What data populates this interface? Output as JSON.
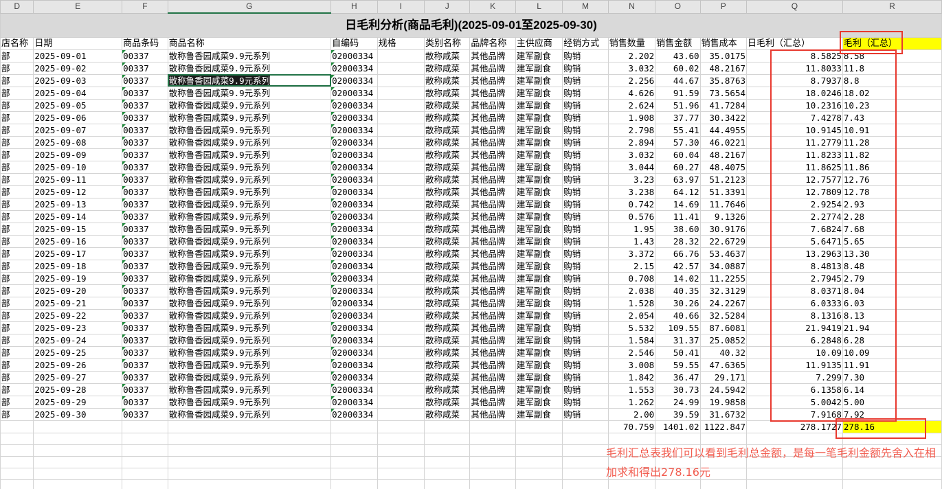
{
  "columns": [
    "D",
    "E",
    "F",
    "G",
    "H",
    "I",
    "J",
    "K",
    "L",
    "M",
    "N",
    "O",
    "P",
    "Q",
    "R"
  ],
  "title": "日毛利分析(商品毛利)(2025-09-01至2025-09-30)",
  "headers": [
    "店名称",
    "日期",
    "商品条码",
    "商品名称",
    "自编码",
    "规格",
    "类别名称",
    "品牌名称",
    "主供应商",
    "经销方式",
    "销售数量",
    "销售金额",
    "销售成本",
    "日毛利（汇总）",
    "毛利（汇总）"
  ],
  "rows": [
    [
      "部",
      "2025-09-01",
      "00337",
      "散称鲁香园咸菜9.9元系列",
      "02000334",
      "",
      "散称咸菜",
      "其他品牌",
      "建军副食",
      "购销",
      "2.202",
      "43.60",
      "35.0175",
      "8.5825",
      "8.58"
    ],
    [
      "部",
      "2025-09-02",
      "00337",
      "散称鲁香园咸菜9.9元系列",
      "02000334",
      "",
      "散称咸菜",
      "其他品牌",
      "建军副食",
      "购销",
      "3.032",
      "60.02",
      "48.2167",
      "11.8033",
      "11.8"
    ],
    [
      "部",
      "2025-09-03",
      "00337",
      "散称鲁香园咸菜9.9元系列",
      "02000334",
      "",
      "散称咸菜",
      "其他品牌",
      "建军副食",
      "购销",
      "2.256",
      "44.67",
      "35.8763",
      "8.7937",
      "8.8"
    ],
    [
      "部",
      "2025-09-04",
      "00337",
      "散称鲁香园咸菜9.9元系列",
      "02000334",
      "",
      "散称咸菜",
      "其他品牌",
      "建军副食",
      "购销",
      "4.626",
      "91.59",
      "73.5654",
      "18.0246",
      "18.02"
    ],
    [
      "部",
      "2025-09-05",
      "00337",
      "散称鲁香园咸菜9.9元系列",
      "02000334",
      "",
      "散称咸菜",
      "其他品牌",
      "建军副食",
      "购销",
      "2.624",
      "51.96",
      "41.7284",
      "10.2316",
      "10.23"
    ],
    [
      "部",
      "2025-09-06",
      "00337",
      "散称鲁香园咸菜9.9元系列",
      "02000334",
      "",
      "散称咸菜",
      "其他品牌",
      "建军副食",
      "购销",
      "1.908",
      "37.77",
      "30.3422",
      "7.4278",
      "7.43"
    ],
    [
      "部",
      "2025-09-07",
      "00337",
      "散称鲁香园咸菜9.9元系列",
      "02000334",
      "",
      "散称咸菜",
      "其他品牌",
      "建军副食",
      "购销",
      "2.798",
      "55.41",
      "44.4955",
      "10.9145",
      "10.91"
    ],
    [
      "部",
      "2025-09-08",
      "00337",
      "散称鲁香园咸菜9.9元系列",
      "02000334",
      "",
      "散称咸菜",
      "其他品牌",
      "建军副食",
      "购销",
      "2.894",
      "57.30",
      "46.0221",
      "11.2779",
      "11.28"
    ],
    [
      "部",
      "2025-09-09",
      "00337",
      "散称鲁香园咸菜9.9元系列",
      "02000334",
      "",
      "散称咸菜",
      "其他品牌",
      "建军副食",
      "购销",
      "3.032",
      "60.04",
      "48.2167",
      "11.8233",
      "11.82"
    ],
    [
      "部",
      "2025-09-10",
      "00337",
      "散称鲁香园咸菜9.9元系列",
      "02000334",
      "",
      "散称咸菜",
      "其他品牌",
      "建军副食",
      "购销",
      "3.044",
      "60.27",
      "48.4075",
      "11.8625",
      "11.86"
    ],
    [
      "部",
      "2025-09-11",
      "00337",
      "散称鲁香园咸菜9.9元系列",
      "02000334",
      "",
      "散称咸菜",
      "其他品牌",
      "建军副食",
      "购销",
      "3.23",
      "63.97",
      "51.2123",
      "12.7577",
      "12.76"
    ],
    [
      "部",
      "2025-09-12",
      "00337",
      "散称鲁香园咸菜9.9元系列",
      "02000334",
      "",
      "散称咸菜",
      "其他品牌",
      "建军副食",
      "购销",
      "3.238",
      "64.12",
      "51.3391",
      "12.7809",
      "12.78"
    ],
    [
      "部",
      "2025-09-13",
      "00337",
      "散称鲁香园咸菜9.9元系列",
      "02000334",
      "",
      "散称咸菜",
      "其他品牌",
      "建军副食",
      "购销",
      "0.742",
      "14.69",
      "11.7646",
      "2.9254",
      "2.93"
    ],
    [
      "部",
      "2025-09-14",
      "00337",
      "散称鲁香园咸菜9.9元系列",
      "02000334",
      "",
      "散称咸菜",
      "其他品牌",
      "建军副食",
      "购销",
      "0.576",
      "11.41",
      "9.1326",
      "2.2774",
      "2.28"
    ],
    [
      "部",
      "2025-09-15",
      "00337",
      "散称鲁香园咸菜9.9元系列",
      "02000334",
      "",
      "散称咸菜",
      "其他品牌",
      "建军副食",
      "购销",
      "1.95",
      "38.60",
      "30.9176",
      "7.6824",
      "7.68"
    ],
    [
      "部",
      "2025-09-16",
      "00337",
      "散称鲁香园咸菜9.9元系列",
      "02000334",
      "",
      "散称咸菜",
      "其他品牌",
      "建军副食",
      "购销",
      "1.43",
      "28.32",
      "22.6729",
      "5.6471",
      "5.65"
    ],
    [
      "部",
      "2025-09-17",
      "00337",
      "散称鲁香园咸菜9.9元系列",
      "02000334",
      "",
      "散称咸菜",
      "其他品牌",
      "建军副食",
      "购销",
      "3.372",
      "66.76",
      "53.4637",
      "13.2963",
      "13.30"
    ],
    [
      "部",
      "2025-09-18",
      "00337",
      "散称鲁香园咸菜9.9元系列",
      "02000334",
      "",
      "散称咸菜",
      "其他品牌",
      "建军副食",
      "购销",
      "2.15",
      "42.57",
      "34.0887",
      "8.4813",
      "8.48"
    ],
    [
      "部",
      "2025-09-19",
      "00337",
      "散称鲁香园咸菜9.9元系列",
      "02000334",
      "",
      "散称咸菜",
      "其他品牌",
      "建军副食",
      "购销",
      "0.708",
      "14.02",
      "11.2255",
      "2.7945",
      "2.79"
    ],
    [
      "部",
      "2025-09-20",
      "00337",
      "散称鲁香园咸菜9.9元系列",
      "02000334",
      "",
      "散称咸菜",
      "其他品牌",
      "建军副食",
      "购销",
      "2.038",
      "40.35",
      "32.3129",
      "8.0371",
      "8.04"
    ],
    [
      "部",
      "2025-09-21",
      "00337",
      "散称鲁香园咸菜9.9元系列",
      "02000334",
      "",
      "散称咸菜",
      "其他品牌",
      "建军副食",
      "购销",
      "1.528",
      "30.26",
      "24.2267",
      "6.0333",
      "6.03"
    ],
    [
      "部",
      "2025-09-22",
      "00337",
      "散称鲁香园咸菜9.9元系列",
      "02000334",
      "",
      "散称咸菜",
      "其他品牌",
      "建军副食",
      "购销",
      "2.054",
      "40.66",
      "32.5284",
      "8.1316",
      "8.13"
    ],
    [
      "部",
      "2025-09-23",
      "00337",
      "散称鲁香园咸菜9.9元系列",
      "02000334",
      "",
      "散称咸菜",
      "其他品牌",
      "建军副食",
      "购销",
      "5.532",
      "109.55",
      "87.6081",
      "21.9419",
      "21.94"
    ],
    [
      "部",
      "2025-09-24",
      "00337",
      "散称鲁香园咸菜9.9元系列",
      "02000334",
      "",
      "散称咸菜",
      "其他品牌",
      "建军副食",
      "购销",
      "1.584",
      "31.37",
      "25.0852",
      "6.2848",
      "6.28"
    ],
    [
      "部",
      "2025-09-25",
      "00337",
      "散称鲁香园咸菜9.9元系列",
      "02000334",
      "",
      "散称咸菜",
      "其他品牌",
      "建军副食",
      "购销",
      "2.546",
      "50.41",
      "40.32",
      "10.09",
      "10.09"
    ],
    [
      "部",
      "2025-09-26",
      "00337",
      "散称鲁香园咸菜9.9元系列",
      "02000334",
      "",
      "散称咸菜",
      "其他品牌",
      "建军副食",
      "购销",
      "3.008",
      "59.55",
      "47.6365",
      "11.9135",
      "11.91"
    ],
    [
      "部",
      "2025-09-27",
      "00337",
      "散称鲁香园咸菜9.9元系列",
      "02000334",
      "",
      "散称咸菜",
      "其他品牌",
      "建军副食",
      "购销",
      "1.842",
      "36.47",
      "29.171",
      "7.299",
      "7.30"
    ],
    [
      "部",
      "2025-09-28",
      "00337",
      "散称鲁香园咸菜9.9元系列",
      "02000334",
      "",
      "散称咸菜",
      "其他品牌",
      "建军副食",
      "购销",
      "1.553",
      "30.73",
      "24.5942",
      "6.1358",
      "6.14"
    ],
    [
      "部",
      "2025-09-29",
      "00337",
      "散称鲁香园咸菜9.9元系列",
      "02000334",
      "",
      "散称咸菜",
      "其他品牌",
      "建军副食",
      "购销",
      "1.262",
      "24.99",
      "19.9858",
      "5.0042",
      "5.00"
    ],
    [
      "部",
      "2025-09-30",
      "00337",
      "散称鲁香园咸菜9.9元系列",
      "02000334",
      "",
      "散称咸菜",
      "其他品牌",
      "建军副食",
      "购销",
      "2.00",
      "39.59",
      "31.6732",
      "7.9168",
      "7.92"
    ]
  ],
  "totals": {
    "qty": "70.759",
    "amount": "1401.02",
    "cost": "1122.847",
    "daily_profit": "278.1727",
    "profit": "278.16"
  },
  "annotation": "毛利汇总表我们可以看到毛利总金额，是每一笔毛利金额先舍入在相加求和得出278.16元",
  "colors": {
    "highlight": "#ffff00",
    "annotation_red": "#e8392f",
    "selection_green": "#217346"
  }
}
